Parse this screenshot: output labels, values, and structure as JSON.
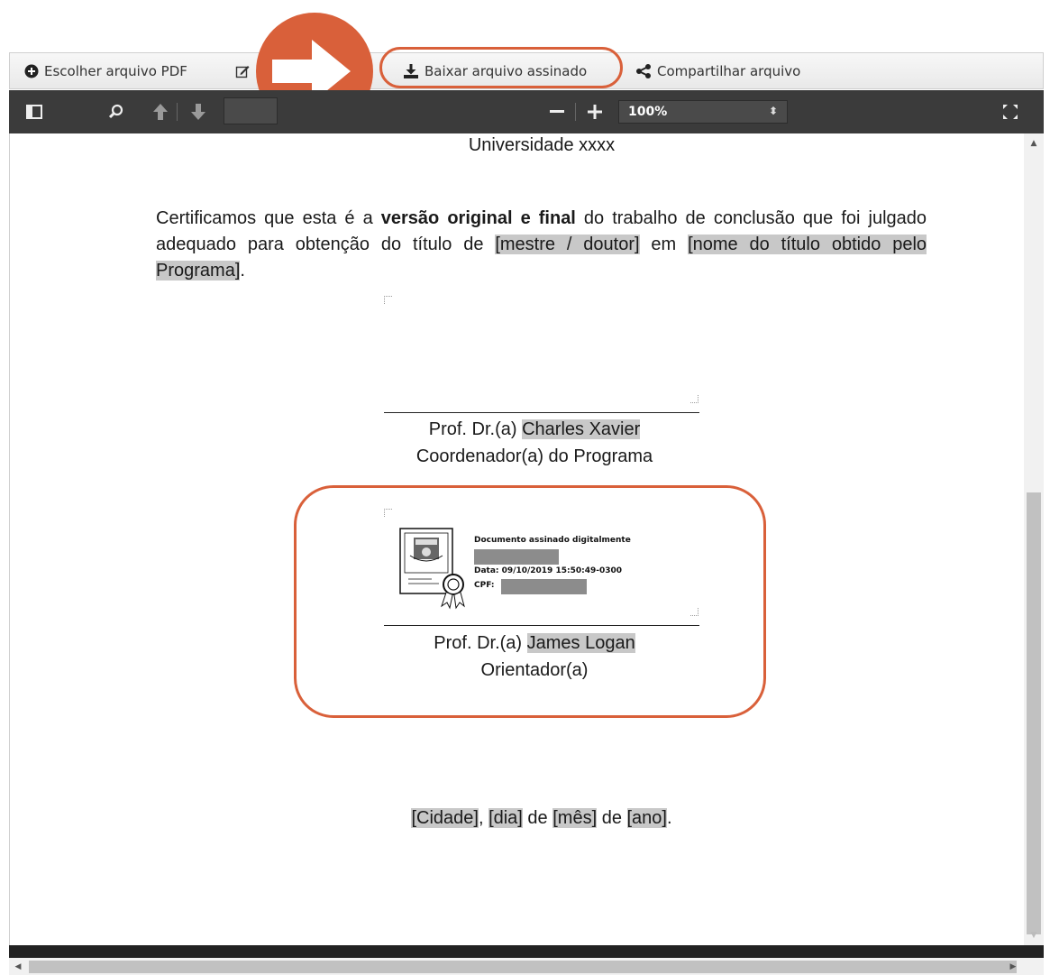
{
  "toolbar": {
    "choose_pdf_label": "Escolher arquivo PDF",
    "download_signed_label": "Baixar arquivo assinado",
    "share_label": "Compartilhar arquivo"
  },
  "viewer": {
    "zoom_value": "100%",
    "icons": [
      "sidebar-toggle-icon",
      "search-icon",
      "arrow-up-icon",
      "arrow-down-icon",
      "zoom-out-icon",
      "zoom-in-icon",
      "fullscreen-icon"
    ]
  },
  "document": {
    "university": "Universidade xxxx",
    "para_part1": "Certificamos que esta é a ",
    "para_bold": "versão original e final",
    "para_part2": " do trabalho de conclusão que foi julgado adequado para obtenção do título de ",
    "para_hl1": "[mestre / doutor]",
    "para_part3": " em ",
    "para_hl2": "[nome do título obtido pelo Programa]",
    "para_part4": ".",
    "coordinator": {
      "prefix": "Prof. Dr.(a) ",
      "name": "Charles Xavier",
      "role": "Coordenador(a) do Programa"
    },
    "signature": {
      "title": "Documento assinado digitalmente",
      "date_line": "Data: 09/10/2019 15:50:49-0300",
      "cpf_label": "CPF:"
    },
    "advisor": {
      "prefix": "Prof. Dr.(a) ",
      "name": "James Logan",
      "role": "Orientador(a)"
    },
    "place_date": {
      "city": "[Cidade]",
      "sep1": ", ",
      "day": "[dia]",
      "de1": " de ",
      "month": "[mês]",
      "de2": " de ",
      "year": "[ano]",
      "end": "."
    }
  },
  "colors": {
    "accent": "#d9603a",
    "toolbar_dark": "#3b3b3b",
    "highlight": "#c8c8c8"
  }
}
